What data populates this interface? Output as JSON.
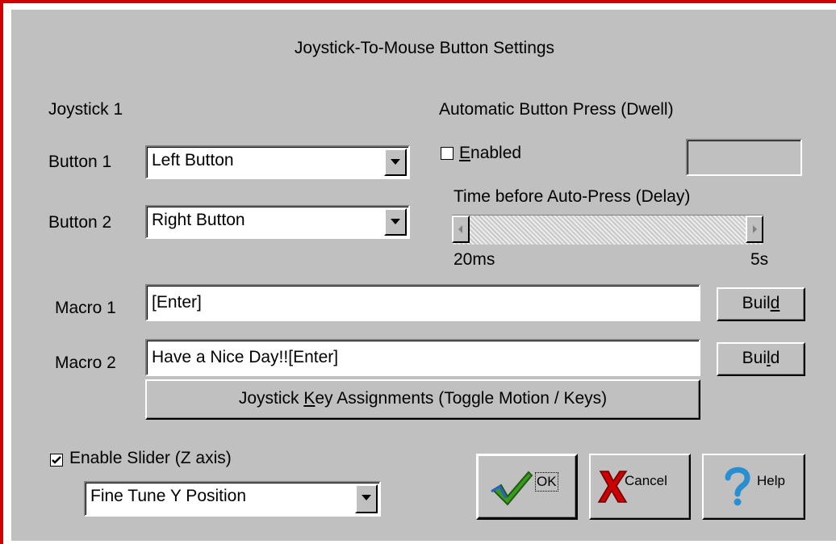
{
  "dialog": {
    "title": "Joystick-To-Mouse Button Settings",
    "joystick_label": "Joystick 1",
    "button1": {
      "label": "Button 1",
      "value": "Left Button"
    },
    "button2": {
      "label": "Button 2",
      "value": "Right Button"
    },
    "dwell": {
      "heading": "Automatic Button Press (Dwell)",
      "enabled_label_u": "E",
      "enabled_label_rest": "nabled",
      "enabled_checked": false,
      "delay_label": "Time before Auto-Press (Delay)",
      "min_label": "20ms",
      "max_label": "5s",
      "slider_value_fraction": 0.0
    },
    "macro1": {
      "label": "Macro 1",
      "value": "[Enter]",
      "build_pre": "Buil",
      "build_u": "d"
    },
    "macro2": {
      "label": "Macro 2",
      "value": "Have a Nice Day!![Enter]",
      "build_pre": "Bui",
      "build_u": "l",
      "build_post": "d"
    },
    "key_assign": {
      "pre": "Joystick ",
      "u": "K",
      "post": "ey Assignments (Toggle Motion / Keys)"
    },
    "slider_enable": {
      "label": "Enable Slider (Z axis)",
      "checked": true
    },
    "slider_mode": {
      "value": "Fine Tune Y Position"
    },
    "ok_label": "OK",
    "cancel_label": "Cancel",
    "help_label": "Help"
  },
  "colors": {
    "accent_border": "#d40000",
    "dialog_bg": "#c0c0c0",
    "check_green": "#3a9a1f",
    "cancel_red": "#cc0000",
    "help_blue": "#2a8fd0"
  }
}
